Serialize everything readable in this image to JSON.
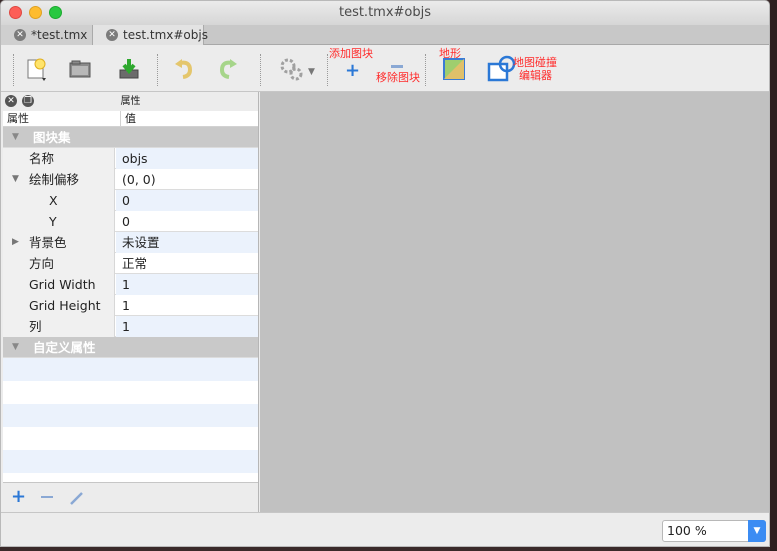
{
  "window": {
    "title": "test.tmx#objs"
  },
  "tabs": [
    {
      "label": "*test.tmx"
    },
    {
      "label": "test.tmx#objs"
    }
  ],
  "toolbar": {
    "add_tile_label": "添加图块",
    "remove_tile_label": "移除图块",
    "terrain_label": "地形",
    "collision_label_line1": "地图碰撞",
    "collision_label_line2": "编辑器"
  },
  "properties_panel": {
    "title": "属性",
    "column_property": "属性",
    "column_value": "值",
    "groups": {
      "tileset": "图块集",
      "custom": "自定义属性"
    },
    "rows": [
      {
        "key": "名称",
        "value": "objs"
      },
      {
        "key": "绘制偏移",
        "value": "(0, 0)"
      },
      {
        "key": "X",
        "value": "0"
      },
      {
        "key": "Y",
        "value": "0"
      },
      {
        "key": "背景色",
        "value": "未设置"
      },
      {
        "key": "方向",
        "value": "正常"
      },
      {
        "key": "Grid Width",
        "value": "1"
      },
      {
        "key": "Grid Height",
        "value": "1"
      },
      {
        "key": "列",
        "value": "1"
      }
    ]
  },
  "statusbar": {
    "zoom": "100 %"
  },
  "colors": {
    "accent": "#3b8cf3",
    "annotation_red": "#ff2b2b",
    "canvas": "#c1c1c1"
  }
}
